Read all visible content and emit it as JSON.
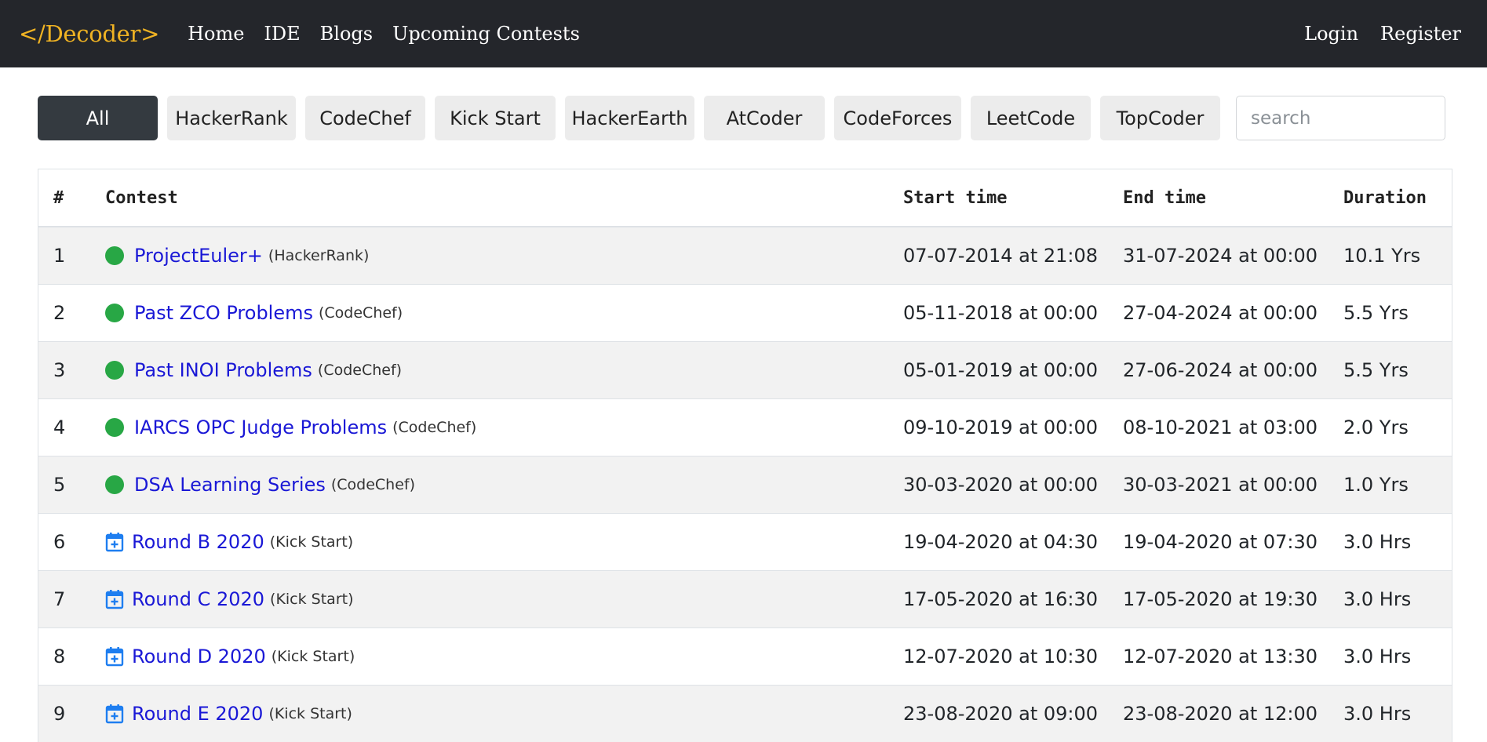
{
  "nav": {
    "brand": "</Decoder>",
    "links": [
      "Home",
      "IDE",
      "Blogs",
      "Upcoming Contests"
    ],
    "auth": [
      "Login",
      "Register"
    ]
  },
  "filters": {
    "buttons": [
      "All",
      "HackerRank",
      "CodeChef",
      "Kick Start",
      "HackerEarth",
      "AtCoder",
      "CodeForces",
      "LeetCode",
      "TopCoder"
    ],
    "active": "All",
    "search_placeholder": "search"
  },
  "colors": {
    "navbar": "#24262b",
    "brand": "#f0b323",
    "link": "#1a18d6",
    "ongoing": "#28a745",
    "calendar": "#1e7ef0"
  },
  "table": {
    "headers": [
      "#",
      "Contest",
      "Start time",
      "End time",
      "Duration"
    ],
    "rows": [
      {
        "num": "1",
        "status": "ongoing",
        "icon": "green-dot",
        "name": "ProjectEuler+",
        "platform": "(HackerRank)",
        "start": "07-07-2014 at 21:08",
        "end": "31-07-2024 at 00:00",
        "duration": "10.1 Yrs"
      },
      {
        "num": "2",
        "status": "ongoing",
        "icon": "green-dot",
        "name": "Past ZCO Problems",
        "platform": "(CodeChef)",
        "start": "05-11-2018 at 00:00",
        "end": "27-04-2024 at 00:00",
        "duration": "5.5 Yrs"
      },
      {
        "num": "3",
        "status": "ongoing",
        "icon": "green-dot",
        "name": "Past INOI Problems",
        "platform": "(CodeChef)",
        "start": "05-01-2019 at 00:00",
        "end": "27-06-2024 at 00:00",
        "duration": "5.5 Yrs"
      },
      {
        "num": "4",
        "status": "ongoing",
        "icon": "green-dot",
        "name": "IARCS OPC Judge Problems",
        "platform": "(CodeChef)",
        "start": "09-10-2019 at 00:00",
        "end": "08-10-2021 at 03:00",
        "duration": "2.0 Yrs"
      },
      {
        "num": "5",
        "status": "ongoing",
        "icon": "green-dot",
        "name": "DSA Learning Series",
        "platform": "(CodeChef)",
        "start": "30-03-2020 at 00:00",
        "end": "30-03-2021 at 00:00",
        "duration": "1.0 Yrs"
      },
      {
        "num": "6",
        "status": "upcoming",
        "icon": "calendar-plus-icon",
        "name": "Round B 2020",
        "platform": "(Kick Start)",
        "start": "19-04-2020 at 04:30",
        "end": "19-04-2020 at 07:30",
        "duration": "3.0 Hrs"
      },
      {
        "num": "7",
        "status": "upcoming",
        "icon": "calendar-plus-icon",
        "name": "Round C 2020",
        "platform": "(Kick Start)",
        "start": "17-05-2020 at 16:30",
        "end": "17-05-2020 at 19:30",
        "duration": "3.0 Hrs"
      },
      {
        "num": "8",
        "status": "upcoming",
        "icon": "calendar-plus-icon",
        "name": "Round D 2020",
        "platform": "(Kick Start)",
        "start": "12-07-2020 at 10:30",
        "end": "12-07-2020 at 13:30",
        "duration": "3.0 Hrs"
      },
      {
        "num": "9",
        "status": "upcoming",
        "icon": "calendar-plus-icon",
        "name": "Round E 2020",
        "platform": "(Kick Start)",
        "start": "23-08-2020 at 09:00",
        "end": "23-08-2020 at 12:00",
        "duration": "3.0 Hrs"
      }
    ]
  }
}
